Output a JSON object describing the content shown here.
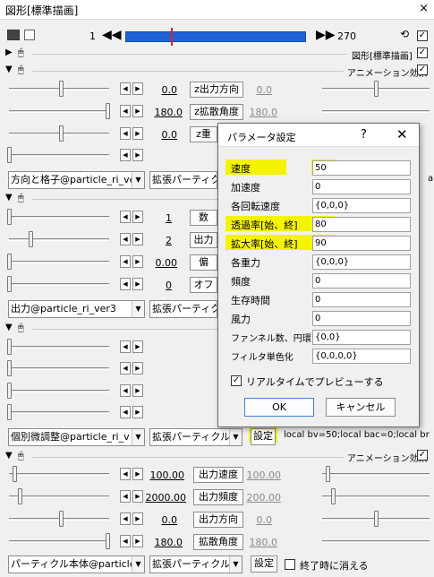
{
  "window": {
    "title": "図形[標準描画]",
    "close_glyph": "×"
  },
  "timeline": {
    "start": "1",
    "end": "270"
  },
  "headers": {
    "shape": "図形[標準描画]",
    "anim1": "アニメーション効果",
    "anim2": "アニメーション効果"
  },
  "group1": {
    "rows": [
      {
        "value": "0.0",
        "label": "z出力方向",
        "value2": "0.0"
      },
      {
        "value": "180.0",
        "label": "z拡散角度",
        "value2": "180.0"
      },
      {
        "value": "0.0",
        "label": "z重",
        "value2": ""
      }
    ],
    "combo": "方向と格子@particle_ri_ve",
    "combo2": "拡張パーティクル"
  },
  "group2": {
    "rows": [
      {
        "value": "1",
        "label": "数"
      },
      {
        "value": "2",
        "label": "出力"
      },
      {
        "value": "0.00",
        "label": "偏"
      },
      {
        "value": "0",
        "label": "オフ"
      }
    ],
    "combo": "出力@particle_ri_ver3",
    "combo2": "拡張パーティクル"
  },
  "group3": {
    "combo": "個別微調整@particle_ri_v",
    "combo2": "拡張パーティクル(",
    "settings": "設定",
    "script_text": "local bv=50;local bac=0;local br"
  },
  "group4": {
    "rows": [
      {
        "value": "100.00",
        "label": "出力速度",
        "value2": "100.00"
      },
      {
        "value": "2000.00",
        "label": "出力頻度",
        "value2": "200.00"
      },
      {
        "value": "0.0",
        "label": "出力方向",
        "value2": "0.0"
      },
      {
        "value": "180.0",
        "label": "拡散角度",
        "value2": "180.0"
      }
    ],
    "combo": "パーティクル本体@particle_",
    "combo2": "拡張パーティクル(",
    "settings": "設定",
    "checkbox_label": "終了時に消える"
  },
  "dialog": {
    "title": "パラメータ設定",
    "help": "?",
    "close": "✕",
    "params": [
      {
        "label": "速度",
        "value": "50"
      },
      {
        "label": "加速度",
        "value": "0"
      },
      {
        "label": "各回転速度",
        "value": "{0,0,0}"
      },
      {
        "label": "透過率[始、終]",
        "value": "80"
      },
      {
        "label": "拡大率[始、終]",
        "value": "90"
      },
      {
        "label": "各重力",
        "value": "{0,0,0}"
      },
      {
        "label": "頻度",
        "value": "0"
      },
      {
        "label": "生存時間",
        "value": "0"
      },
      {
        "label": "風力",
        "value": "0"
      },
      {
        "label": "ファンネル数、円環",
        "value": "{0,0}"
      },
      {
        "label": "フィルタ単色化",
        "value": "{0,0,0,0}"
      }
    ],
    "realtime_label": "リアルタイムでプレビューする",
    "ok": "OK",
    "cancel": "キャンセル"
  },
  "colors": {
    "highlight": "#f4f400",
    "timeline_blue": "#1e62d6",
    "cursor_red": "#e02020"
  }
}
